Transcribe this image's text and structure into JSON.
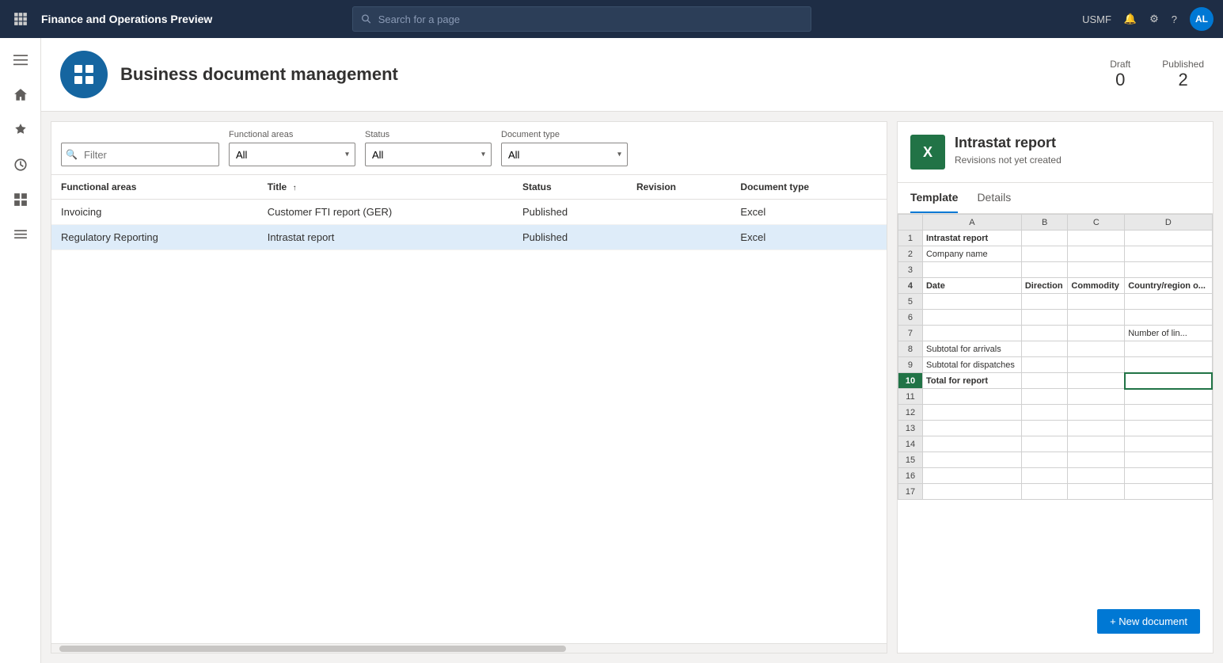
{
  "nav": {
    "app_title": "Finance and Operations Preview",
    "search_placeholder": "Search for a page",
    "user_company": "USMF",
    "user_initials": "AL"
  },
  "page": {
    "title": "Business document management",
    "stats": {
      "draft_label": "Draft",
      "draft_value": "0",
      "published_label": "Published",
      "published_value": "2"
    }
  },
  "filters": {
    "search_placeholder": "Filter",
    "functional_areas_label": "Functional areas",
    "functional_areas_value": "All",
    "status_label": "Status",
    "status_value": "All",
    "document_type_label": "Document type",
    "document_type_value": "All"
  },
  "table": {
    "columns": [
      {
        "id": "functional_areas",
        "label": "Functional areas"
      },
      {
        "id": "title",
        "label": "Title",
        "sorted": true,
        "sort_dir": "asc"
      },
      {
        "id": "status",
        "label": "Status"
      },
      {
        "id": "revision",
        "label": "Revision"
      },
      {
        "id": "document_type",
        "label": "Document type"
      }
    ],
    "rows": [
      {
        "functional_areas": "Invoicing",
        "title": "Customer FTI report (GER)",
        "status": "Published",
        "revision": "",
        "document_type": "Excel"
      },
      {
        "functional_areas": "Regulatory Reporting",
        "title": "Intrastat report",
        "status": "Published",
        "revision": "",
        "document_type": "Excel"
      }
    ]
  },
  "right_panel": {
    "title": "Intrastat report",
    "subtitle": "Revisions not yet created",
    "tabs": [
      {
        "id": "template",
        "label": "Template"
      },
      {
        "id": "details",
        "label": "Details"
      }
    ],
    "active_tab": "template",
    "excel": {
      "col_headers": [
        "",
        "A",
        "B",
        "C",
        "D"
      ],
      "rows": [
        {
          "num": "1",
          "a": "Intrastat report",
          "b": "",
          "c": "",
          "d": "",
          "bold_a": true
        },
        {
          "num": "2",
          "a": "Company name",
          "b": "",
          "c": "",
          "d": ""
        },
        {
          "num": "3",
          "a": "",
          "b": "",
          "c": "",
          "d": ""
        },
        {
          "num": "4",
          "a": "Date",
          "b": "Direction",
          "c": "Commodity",
          "d": "Country/region o...",
          "bold": true
        },
        {
          "num": "5",
          "a": "",
          "b": "",
          "c": "",
          "d": ""
        },
        {
          "num": "6",
          "a": "",
          "b": "",
          "c": "",
          "d": ""
        },
        {
          "num": "7",
          "a": "",
          "b": "",
          "c": "",
          "d": "Number of lin..."
        },
        {
          "num": "8",
          "a": "Subtotal for arrivals",
          "b": "",
          "c": "",
          "d": ""
        },
        {
          "num": "9",
          "a": "Subtotal for dispatches",
          "b": "",
          "c": "",
          "d": ""
        },
        {
          "num": "10",
          "a": "Total for report",
          "b": "",
          "c": "",
          "d": "",
          "bold": true
        },
        {
          "num": "11",
          "a": "",
          "b": "",
          "c": "",
          "d": ""
        },
        {
          "num": "12",
          "a": "",
          "b": "",
          "c": "",
          "d": ""
        },
        {
          "num": "13",
          "a": "",
          "b": "",
          "c": "",
          "d": ""
        },
        {
          "num": "14",
          "a": "",
          "b": "",
          "c": "",
          "d": ""
        },
        {
          "num": "15",
          "a": "",
          "b": "",
          "c": "",
          "d": ""
        },
        {
          "num": "16",
          "a": "",
          "b": "",
          "c": "",
          "d": ""
        },
        {
          "num": "17",
          "a": "",
          "b": "",
          "c": "",
          "d": ""
        }
      ]
    },
    "new_doc_label": "+ New document"
  }
}
